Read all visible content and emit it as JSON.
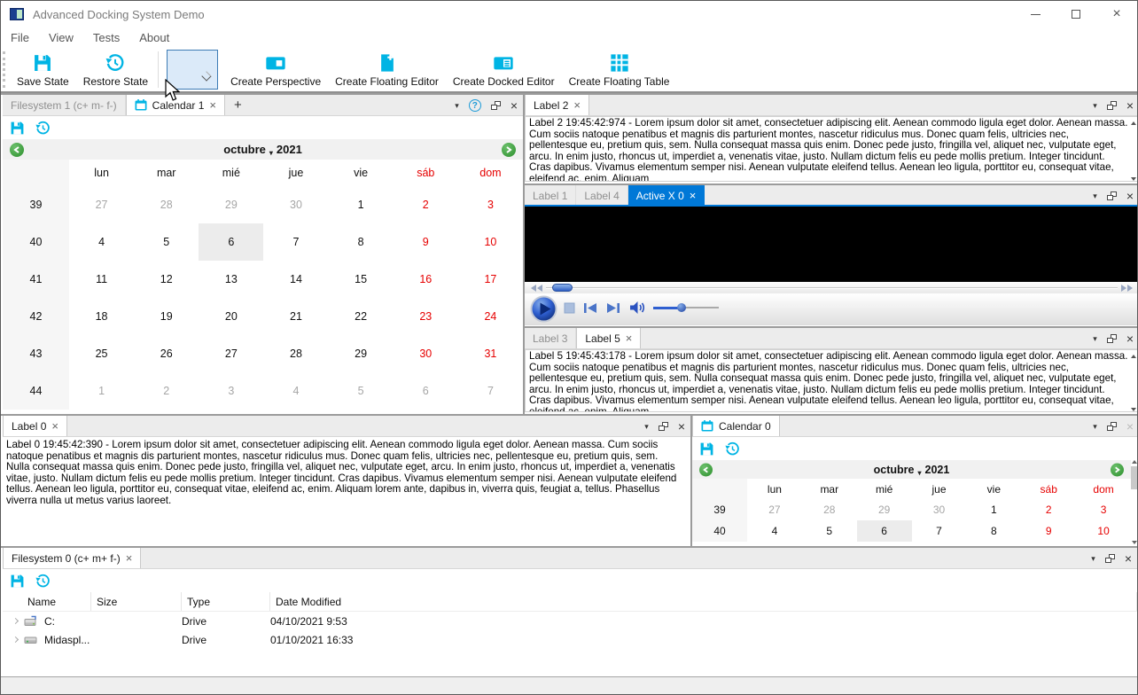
{
  "window": {
    "title": "Advanced Docking System Demo"
  },
  "menu": {
    "items": [
      "File",
      "View",
      "Tests",
      "About"
    ]
  },
  "toolbar": {
    "save_label": "Save State",
    "restore_label": "Restore State",
    "combo_value": "",
    "create_perspective_label": "Create Perspective",
    "create_floating_editor_label": "Create Floating Editor",
    "create_docked_editor_label": "Create Docked Editor",
    "create_floating_table_label": "Create Floating Table"
  },
  "glyphs": {
    "menu_arrow": "▾",
    "close": "×",
    "add_tab": "+",
    "help": "?"
  },
  "colors": {
    "accent_cyan": "#00b4e4",
    "active_tab_blue": "#0078d7",
    "weekend_red": "#e60000",
    "nav_green": "#2f9e33"
  },
  "panels": {
    "calendar1": {
      "tab_filesystem": "Filesystem 1 (c+ m- f-)",
      "tab_calendar": "Calendar 1",
      "calendar": {
        "month": "octubre",
        "year": "2021",
        "day_headers": [
          "lun",
          "mar",
          "mié",
          "jue",
          "vie",
          "sáb",
          "dom"
        ],
        "selected_day": "6",
        "weeks": [
          {
            "num": "39",
            "days": [
              "27",
              "28",
              "29",
              "30",
              "1",
              "2",
              "3"
            ]
          },
          {
            "num": "40",
            "days": [
              "4",
              "5",
              "6",
              "7",
              "8",
              "9",
              "10"
            ]
          },
          {
            "num": "41",
            "days": [
              "11",
              "12",
              "13",
              "14",
              "15",
              "16",
              "17"
            ]
          },
          {
            "num": "42",
            "days": [
              "18",
              "19",
              "20",
              "21",
              "22",
              "23",
              "24"
            ]
          },
          {
            "num": "43",
            "days": [
              "25",
              "26",
              "27",
              "28",
              "29",
              "30",
              "31"
            ]
          },
          {
            "num": "44",
            "days": [
              "1",
              "2",
              "3",
              "4",
              "5",
              "6",
              "7"
            ]
          }
        ]
      }
    },
    "label2": {
      "tab": "Label 2",
      "text": "Label 2 19:45:42:974 - Lorem ipsum dolor sit amet, consectetuer adipiscing elit. Aenean commodo ligula eget dolor. Aenean massa. Cum sociis natoque penatibus et magnis dis parturient montes, nascetur ridiculus mus. Donec quam felis, ultricies nec, pellentesque eu, pretium quis, sem. Nulla consequat massa quis enim. Donec pede justo, fringilla vel, aliquet nec, vulputate eget, arcu. In enim justo, rhoncus ut, imperdiet a, venenatis vitae, justo. Nullam dictum felis eu pede mollis pretium. Integer tincidunt. Cras dapibus. Vivamus elementum semper nisi. Aenean vulputate eleifend tellus. Aenean leo ligula, porttitor eu, consequat vitae, eleifend ac, enim. Aliquam"
    },
    "activex": {
      "tab1": "Label 1",
      "tab2": "Label 4",
      "tab3": "Active X 0",
      "media": {
        "seek_position": "2%",
        "volume": "45%"
      }
    },
    "label5": {
      "tab1": "Label 3",
      "tab2": "Label 5",
      "text": "Label 5 19:45:43:178 - Lorem ipsum dolor sit amet, consectetuer adipiscing elit. Aenean commodo ligula eget dolor. Aenean massa. Cum sociis natoque penatibus et magnis dis parturient montes, nascetur ridiculus mus. Donec quam felis, ultricies nec, pellentesque eu, pretium quis, sem. Nulla consequat massa quis enim. Donec pede justo, fringilla vel, aliquet nec, vulputate eget, arcu. In enim justo, rhoncus ut, imperdiet a, venenatis vitae, justo. Nullam dictum felis eu pede mollis pretium. Integer tincidunt. Cras dapibus. Vivamus elementum semper nisi. Aenean vulputate eleifend tellus. Aenean leo ligula, porttitor eu, consequat vitae, eleifend ac, enim. Aliquam"
    },
    "label0": {
      "tab": "Label 0",
      "text": "Label 0 19:45:42:390 - Lorem ipsum dolor sit amet, consectetuer adipiscing elit. Aenean commodo ligula eget dolor. Aenean massa. Cum sociis natoque penatibus et magnis dis parturient montes, nascetur ridiculus mus. Donec quam felis, ultricies nec, pellentesque eu, pretium quis, sem. Nulla consequat massa quis enim. Donec pede justo, fringilla vel, aliquet nec, vulputate eget, arcu. In enim justo, rhoncus ut, imperdiet a, venenatis vitae, justo. Nullam dictum felis eu pede mollis pretium. Integer tincidunt. Cras dapibus. Vivamus elementum semper nisi. Aenean vulputate eleifend tellus. Aenean leo ligula, porttitor eu, consequat vitae, eleifend ac, enim. Aliquam lorem ante, dapibus in, viverra quis, feugiat a, tellus. Phasellus viverra nulla ut metus varius laoreet."
    },
    "calendar0": {
      "tab": "Calendar 0",
      "calendar": {
        "month": "octubre",
        "year": "2021",
        "day_headers": [
          "lun",
          "mar",
          "mié",
          "jue",
          "vie",
          "sáb",
          "dom"
        ],
        "selected_day": "6",
        "weeks": [
          {
            "num": "39",
            "days": [
              "27",
              "28",
              "29",
              "30",
              "1",
              "2",
              "3"
            ]
          },
          {
            "num": "40",
            "days": [
              "4",
              "5",
              "6",
              "7",
              "8",
              "9",
              "10"
            ]
          }
        ]
      }
    },
    "fs0": {
      "tab": "Filesystem 0 (c+ m+ f-)",
      "columns": [
        "Name",
        "Size",
        "Type",
        "Date Modified"
      ],
      "rows": [
        {
          "name": "C:",
          "size": "",
          "type": "Drive",
          "modified": "04/10/2021 9:53"
        },
        {
          "name": "Midaspl...",
          "size": "",
          "type": "Drive",
          "modified": "01/10/2021 16:33"
        }
      ]
    }
  }
}
